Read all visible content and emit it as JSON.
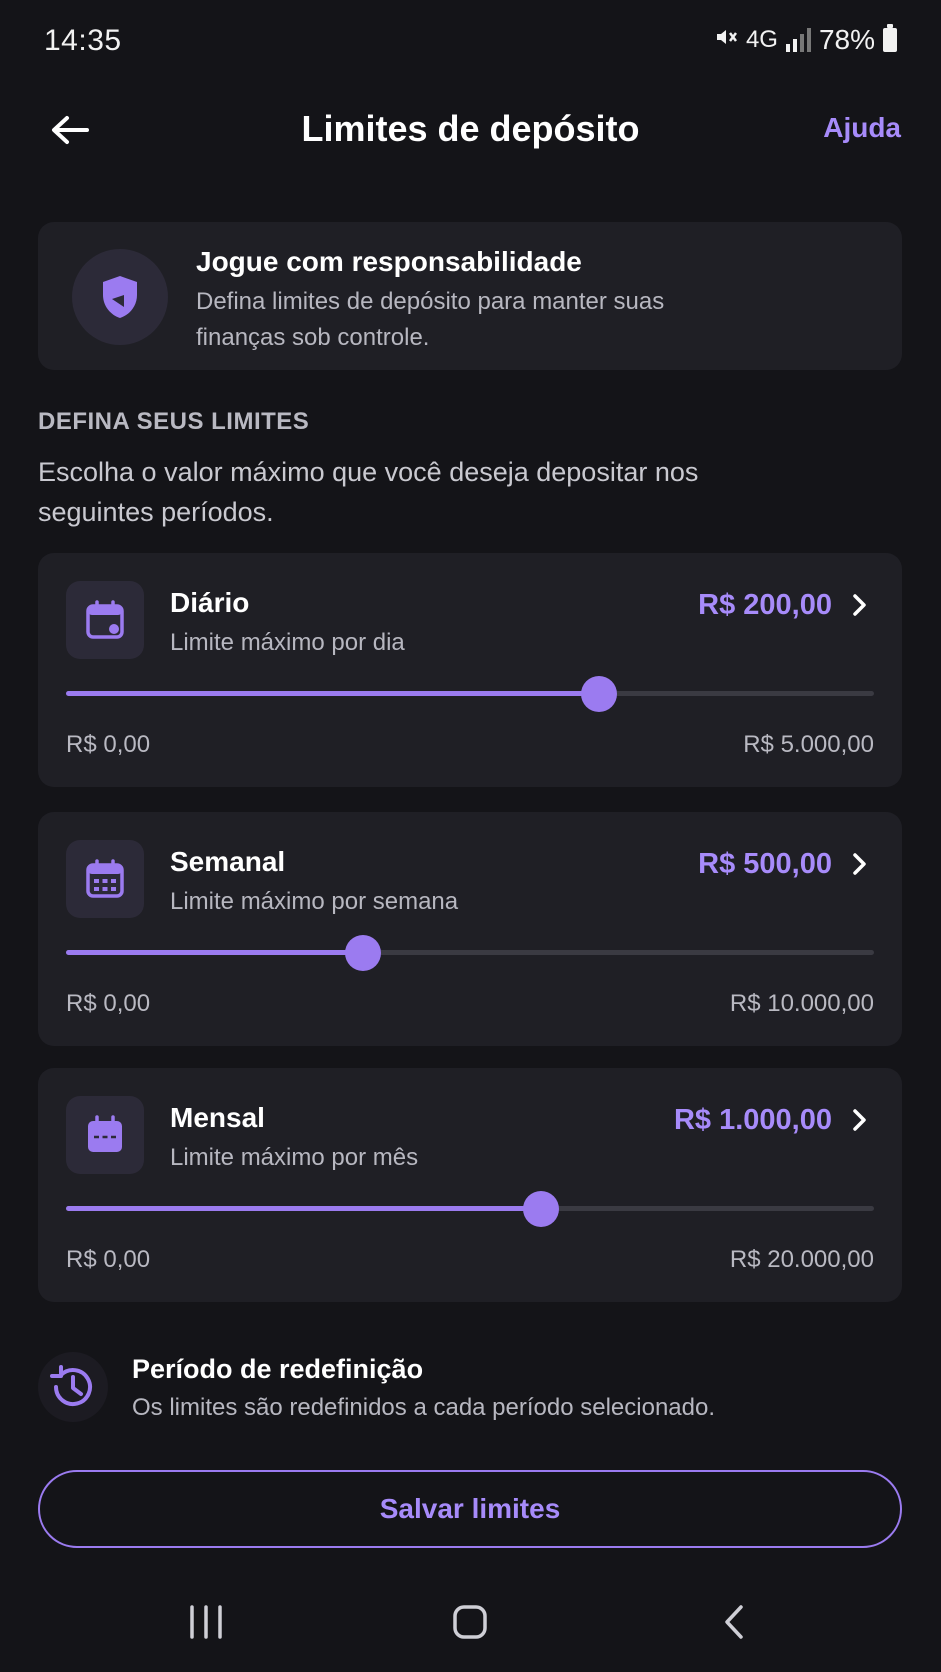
{
  "status_bar": {
    "time": "14:35",
    "network": "4G",
    "battery": "78%"
  },
  "header": {
    "title": "Limites de depósito",
    "help_label": "Ajuda"
  },
  "info_card": {
    "title": "Jogue com responsabilidade",
    "text": "Defina limites de depósito para manter suas finanças sob controle."
  },
  "section": {
    "label": "DEFINA SEUS LIMITES",
    "description": "Escolha o valor máximo que você deseja depositar nos seguintes períodos."
  },
  "limits": [
    {
      "name": "Diário",
      "subtitle": "Limite máximo por dia",
      "value": "R$ 200,00",
      "min": "R$ 0,00",
      "max": "R$ 5.000,00",
      "slider_fraction": 0.66,
      "icon": "calendar-day-icon"
    },
    {
      "name": "Semanal",
      "subtitle": "Limite máximo por semana",
      "value": "R$ 500,00",
      "min": "R$ 0,00",
      "max": "R$ 10.000,00",
      "slider_fraction": 0.368,
      "icon": "calendar-week-icon"
    },
    {
      "name": "Mensal",
      "subtitle": "Limite máximo por mês",
      "value": "R$ 1.000,00",
      "min": "R$ 0,00",
      "max": "R$ 20.000,00",
      "slider_fraction": 0.588,
      "icon": "calendar-month-icon"
    }
  ],
  "reset": {
    "title": "Período de redefinição",
    "text": "Os limites são redefinidos a cada período selecionado."
  },
  "save_label": "Salvar limites",
  "colors": {
    "background": "#141418",
    "card": "#1f1f25",
    "accent": "#9b7bf0",
    "accent_text": "#a78bfa"
  }
}
